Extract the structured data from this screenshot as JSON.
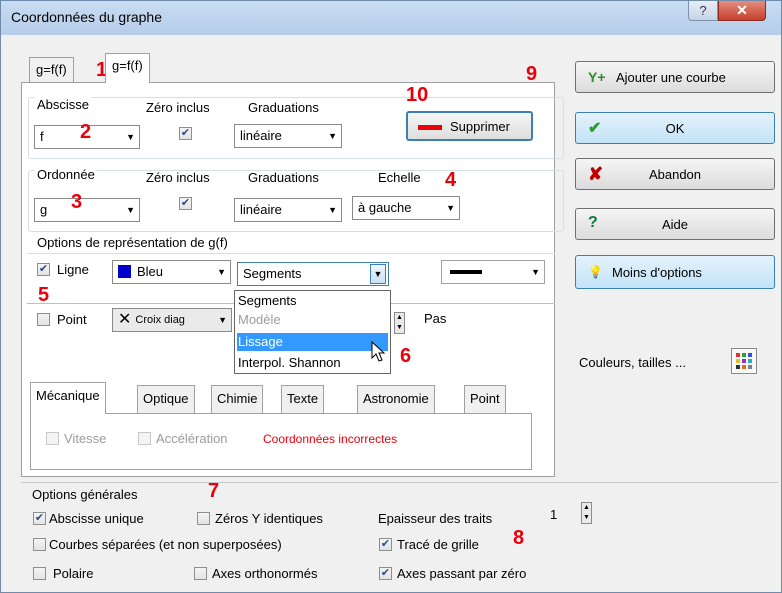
{
  "window": {
    "title": "Coordonnées du graphe",
    "help": "?",
    "close": "✕"
  },
  "tabs": [
    "g=f(f)",
    "g=f(f)"
  ],
  "abscisse": {
    "label": "Abscisse",
    "zero_label": "Zéro inclus",
    "grad_label": "Graduations",
    "var": "f",
    "grad": "linéaire",
    "zero_checked": "✔"
  },
  "ordonnee": {
    "label": "Ordonnée",
    "zero_label": "Zéro inclus",
    "grad_label": "Graduations",
    "echelle_label": "Echelle",
    "var": "g",
    "grad": "linéaire",
    "echelle": "à gauche",
    "zero_checked": "✔"
  },
  "supprimer": "Supprimer",
  "repr": {
    "title": "Options de représentation de g(f)",
    "ligne_label": "Ligne",
    "ligne_checked": "✔",
    "color": "Bleu",
    "color_hex": "#0000cc",
    "type": "Segments",
    "point_label": "Point",
    "point_style": "Croix diag",
    "pas_label": "Pas"
  },
  "dropdown": [
    "Segments",
    "Modèle",
    "Lissage",
    "Interpol. Shannon"
  ],
  "lower_tabs": [
    "Mécanique",
    "Optique",
    "Chimie",
    "Texte",
    "Astronomie",
    "Point"
  ],
  "mecanique": {
    "vitesse": "Vitesse",
    "acceleration": "Accélération",
    "error": "Coordonnées incorrectes",
    "error_color": "#e8000b"
  },
  "side": {
    "add": "Ajouter une courbe",
    "add_icon": "Y+",
    "ok": "OK",
    "ok_icon": "✔",
    "cancel": "Abandon",
    "cancel_icon": "✘",
    "help": "Aide",
    "help_icon": "?",
    "less": "Moins d'options",
    "less_icon": "💡",
    "colors": "Couleurs, tailles ..."
  },
  "general": {
    "title": "Options générales",
    "abscisse_unique": "Abscisse unique",
    "zeros_y": "Zéros Y identiques",
    "epaisseur": "Epaisseur des traits",
    "epaisseur_val": "1",
    "courbes_sep": "Courbes séparées (et non superposées)",
    "grille": "Tracé de grille",
    "polaire": "Polaire",
    "ortho": "Axes orthonormés",
    "zero_axes": "Axes passant par zéro",
    "check": "✔"
  },
  "annotations": [
    "1",
    "2",
    "3",
    "4",
    "5",
    "6",
    "7",
    "8",
    "9",
    "10"
  ]
}
